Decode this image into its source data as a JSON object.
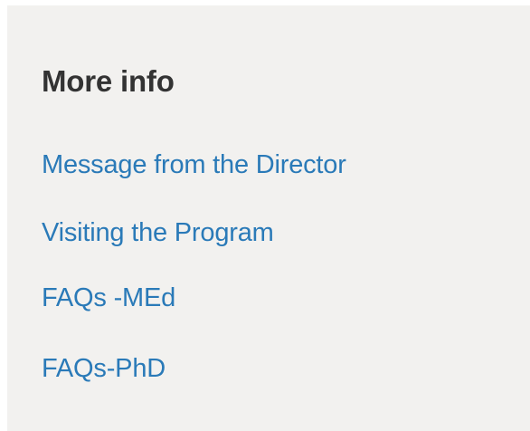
{
  "sidebar": {
    "title": "More info",
    "links": [
      {
        "label": "Message from the Director"
      },
      {
        "label": "Visiting the Program"
      },
      {
        "label": "FAQs -MEd"
      },
      {
        "label": "FAQs-PhD"
      }
    ],
    "colors": {
      "background": "#f2f1ef",
      "title": "#333333",
      "link": "#2a7ab8"
    }
  }
}
